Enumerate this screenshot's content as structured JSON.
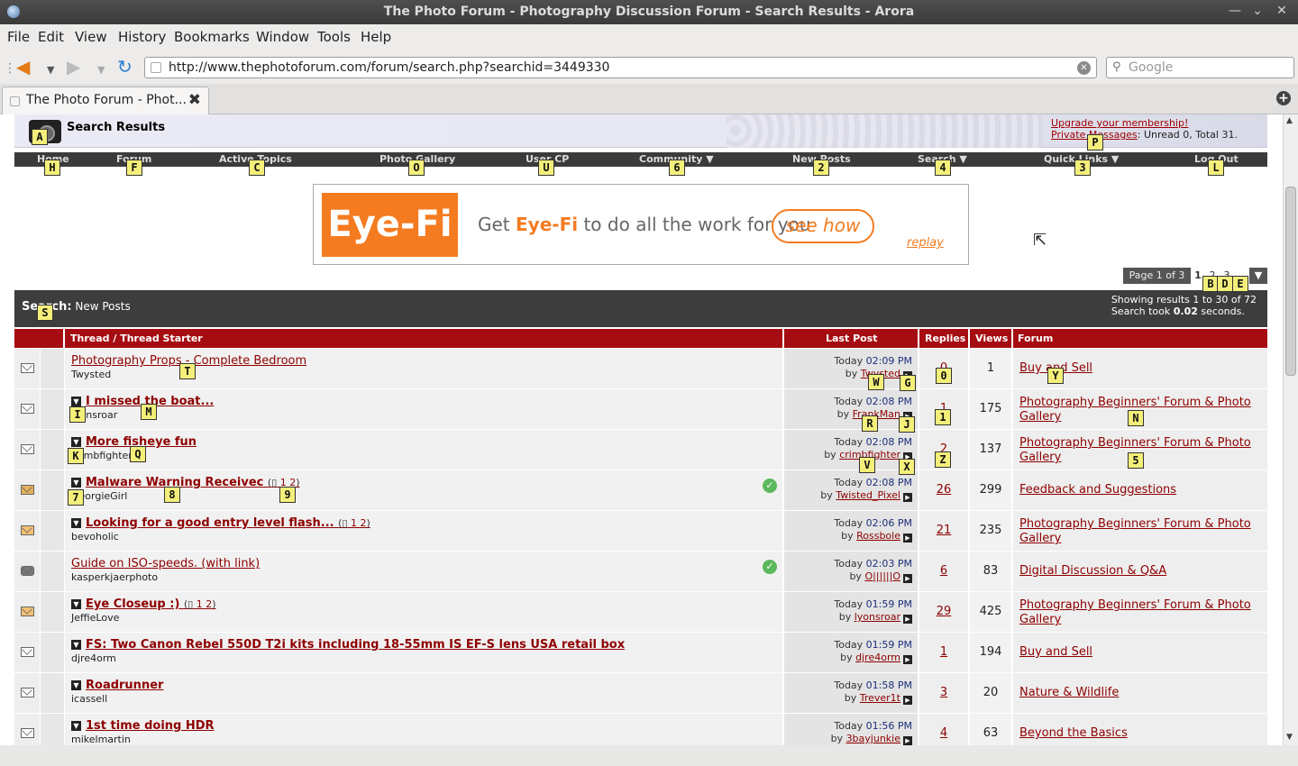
{
  "window": {
    "title": "The Photo Forum - Photography Discussion Forum - Search Results - Arora"
  },
  "menu": [
    "File",
    "Edit",
    "View",
    "History",
    "Bookmarks",
    "Window",
    "Tools",
    "Help"
  ],
  "nav": {
    "url": "http://www.thephotoforum.com/forum/search.php?searchid=3449330",
    "search_placeholder": "Google"
  },
  "tab": {
    "title": "The Photo Forum - Phot..."
  },
  "header": {
    "title": "Search Results",
    "upgrade": "Upgrade your membership!",
    "pm_link": "Private Messages",
    "pm_status": ": Unread 0, Total 31."
  },
  "navstrip": [
    {
      "label": "Home",
      "hint": "H"
    },
    {
      "label": "Forum",
      "hint": "F"
    },
    {
      "label": "Active Topics",
      "hint": "C"
    },
    {
      "label": "Photo Gallery",
      "hint": "O"
    },
    {
      "label": "User CP",
      "hint": "U"
    },
    {
      "label": "Community ▼",
      "hint": "6"
    },
    {
      "label": "New Posts",
      "hint": "2"
    },
    {
      "label": "Search ▼",
      "hint": "4"
    },
    {
      "label": "Quick Links ▼",
      "hint": "3"
    },
    {
      "label": "Log Out",
      "hint": "L"
    }
  ],
  "ad": {
    "logo": "Eye-Fi",
    "tag_pre": "Get ",
    "tag_brand": "Eye-Fi",
    "tag_post": " to do all the work for you",
    "cta": "see how",
    "replay": "replay"
  },
  "pager": {
    "label": "Page 1 of 3",
    "pages": [
      "1",
      "2",
      "3"
    ]
  },
  "results": {
    "heading": "Search:",
    "query": "New Posts",
    "showing": "Showing results 1 to 30 of 72",
    "took_pre": "Search took ",
    "took_val": "0.02",
    "took_post": " seconds."
  },
  "columns": {
    "thread": "Thread / Thread Starter",
    "last": "Last Post",
    "replies": "Replies",
    "views": "Views",
    "forum": "Forum"
  },
  "hints": {
    "A": "A",
    "P": "P",
    "S": "S",
    "B": "B",
    "D": "D",
    "E": "E",
    "T": "T",
    "W": "W",
    "G": "G",
    "Zero": "0",
    "Y": "Y",
    "I": "I",
    "M": "M",
    "R": "R",
    "J": "J",
    "One": "1",
    "N": "N",
    "K": "K",
    "Q": "Q",
    "V": "V",
    "X": "X",
    "Z": "Z",
    "Five": "5",
    "Seven": "7",
    "Eight": "8",
    "Nine": "9"
  },
  "threads": [
    {
      "title": "Photography Props - Complete Bedroom",
      "starter": "Twysted",
      "date": "Today ",
      "time": "02:09 PM",
      "by": "Twysted",
      "replies": "0",
      "views": "1",
      "forum": "Buy and Sell",
      "bold": false,
      "icon": "normal",
      "pages": [],
      "check": false
    },
    {
      "title": "I missed the boat...",
      "starter": "lyonsroar",
      "date": "Today ",
      "time": "02:08 PM",
      "by": "FrankMan",
      "replies": "1",
      "views": "175",
      "forum": "Photography Beginners' Forum & Photo Gallery",
      "bold": true,
      "icon": "normal",
      "pages": [],
      "check": false
    },
    {
      "title": "More fisheye fun",
      "starter": "crimbfighter",
      "date": "Today ",
      "time": "02:08 PM",
      "by": "crimbfighter",
      "replies": "2",
      "views": "137",
      "forum": "Photography Beginners' Forum & Photo Gallery",
      "bold": true,
      "icon": "normal",
      "pages": [],
      "check": false
    },
    {
      "title": "Malware Warning Receivec",
      "starter": "GeorgieGirl",
      "date": "Today ",
      "time": "02:08 PM",
      "by": "Twisted_Pixel",
      "replies": "26",
      "views": "299",
      "forum": "Feedback and Suggestions",
      "bold": true,
      "icon": "lock",
      "pages": [
        "1",
        "2"
      ],
      "check": true
    },
    {
      "title": "Looking for a good entry level flash...",
      "starter": "bevoholic",
      "date": "Today ",
      "time": "02:06 PM",
      "by": "Rossbole",
      "replies": "21",
      "views": "235",
      "forum": "Photography Beginners' Forum & Photo Gallery",
      "bold": true,
      "icon": "hot",
      "pages": [
        "1",
        "2"
      ],
      "check": false
    },
    {
      "title": "Guide on ISO-speeds. (with link)",
      "starter": "kasperkjaerphoto",
      "date": "Today ",
      "time": "02:03 PM",
      "by": "O||||||O",
      "replies": "6",
      "views": "83",
      "forum": "Digital Discussion & Q&A",
      "bold": false,
      "icon": "cam",
      "pages": [],
      "check": true
    },
    {
      "title": "Eye Closeup :)",
      "starter": "JeffieLove",
      "date": "Today ",
      "time": "01:59 PM",
      "by": "lyonsroar",
      "replies": "29",
      "views": "425",
      "forum": "Photography Beginners' Forum & Photo Gallery",
      "bold": true,
      "icon": "hot",
      "pages": [
        "1",
        "2"
      ],
      "check": false
    },
    {
      "title": "FS: Two Canon Rebel 550D T2i kits including 18-55mm IS EF-S lens USA retail box",
      "starter": "djre4orm",
      "date": "Today ",
      "time": "01:59 PM",
      "by": "djre4orm",
      "replies": "1",
      "views": "194",
      "forum": "Buy and Sell",
      "bold": true,
      "icon": "normal",
      "pages": [],
      "check": false
    },
    {
      "title": "Roadrunner",
      "starter": "icassell",
      "date": "Today ",
      "time": "01:58 PM",
      "by": "Trever1t",
      "replies": "3",
      "views": "20",
      "forum": "Nature & Wildlife",
      "bold": true,
      "icon": "normal",
      "pages": [],
      "check": false
    },
    {
      "title": "1st time doing HDR",
      "starter": "mikelmartin",
      "date": "Today ",
      "time": "01:56 PM",
      "by": "3bayjunkie",
      "replies": "4",
      "views": "63",
      "forum": "Beyond the Basics",
      "bold": true,
      "icon": "normal",
      "pages": [],
      "check": false
    }
  ]
}
